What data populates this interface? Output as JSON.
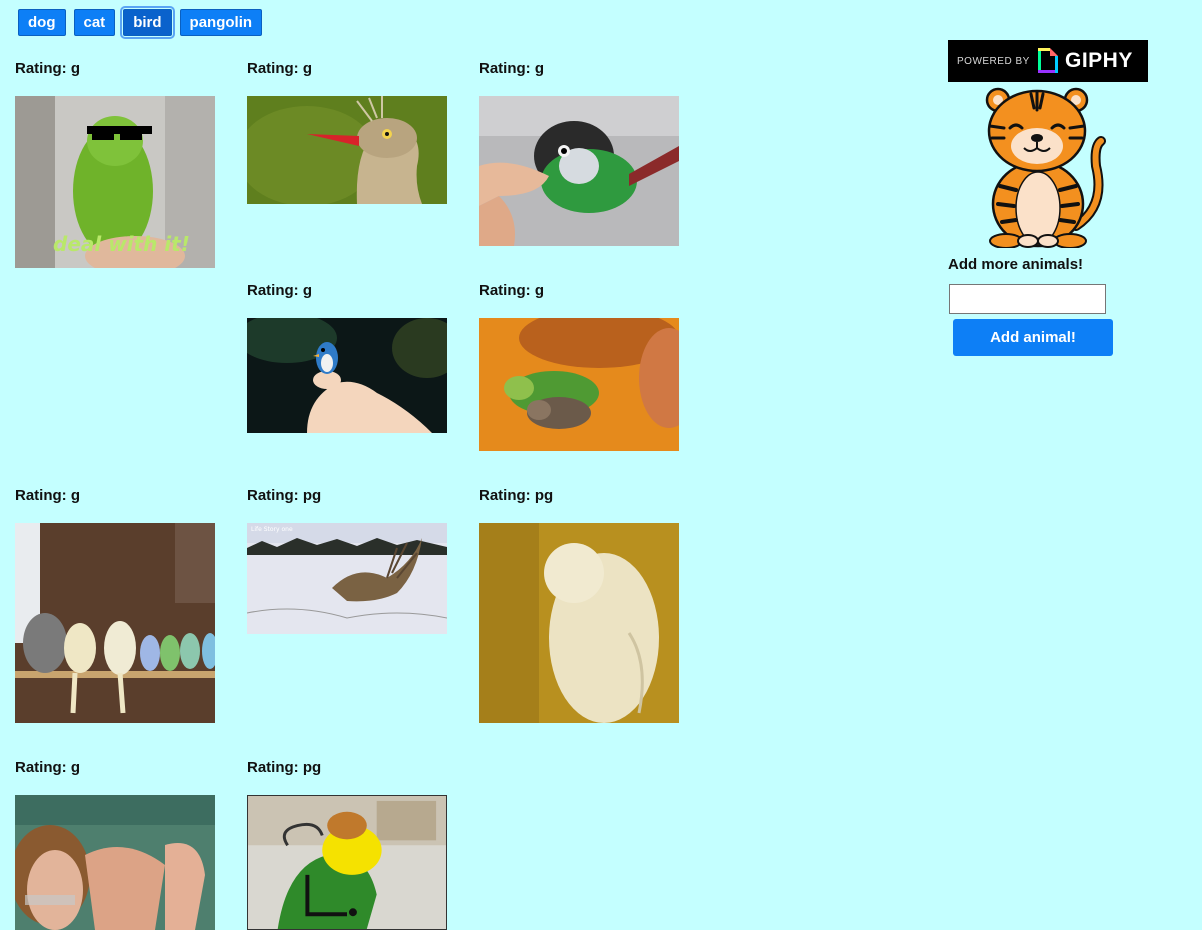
{
  "topics": {
    "buttons": [
      {
        "label": "dog",
        "active": false
      },
      {
        "label": "cat",
        "active": false
      },
      {
        "label": "bird",
        "active": true
      },
      {
        "label": "pangolin",
        "active": false
      }
    ]
  },
  "gifs": [
    {
      "rating": "Rating: g",
      "caption": "deal with it!",
      "kind": "parakeet-sunglasses"
    },
    {
      "rating": "Rating: g",
      "kind": "seriema"
    },
    {
      "rating": "Rating: g",
      "kind": "conure-finger"
    },
    {
      "rating": "Rating: g",
      "kind": "bluebird-finger"
    },
    {
      "rating": "Rating: g",
      "kind": "parakeet-cat"
    },
    {
      "rating": "Rating: g",
      "kind": "cockatiels-perch"
    },
    {
      "rating": "Rating: pg",
      "watermark": "Life Story one",
      "kind": "grouse-snow"
    },
    {
      "rating": "Rating: pg",
      "kind": "cockatoo-dance"
    },
    {
      "rating": "Rating: g",
      "kind": "napoleon-clap"
    },
    {
      "rating": "Rating: pg",
      "kind": "caique-dance"
    }
  ],
  "sidebar": {
    "powered_by": "POWERED BY",
    "giphy": "GIPHY",
    "add_label": "Add more animals!",
    "input_value": "",
    "add_button": "Add animal!",
    "mascot": "tiger-mascot"
  },
  "colors": {
    "background": "#c4ffff",
    "button": "#0d7ff6",
    "button_active": "#0a62cc"
  }
}
